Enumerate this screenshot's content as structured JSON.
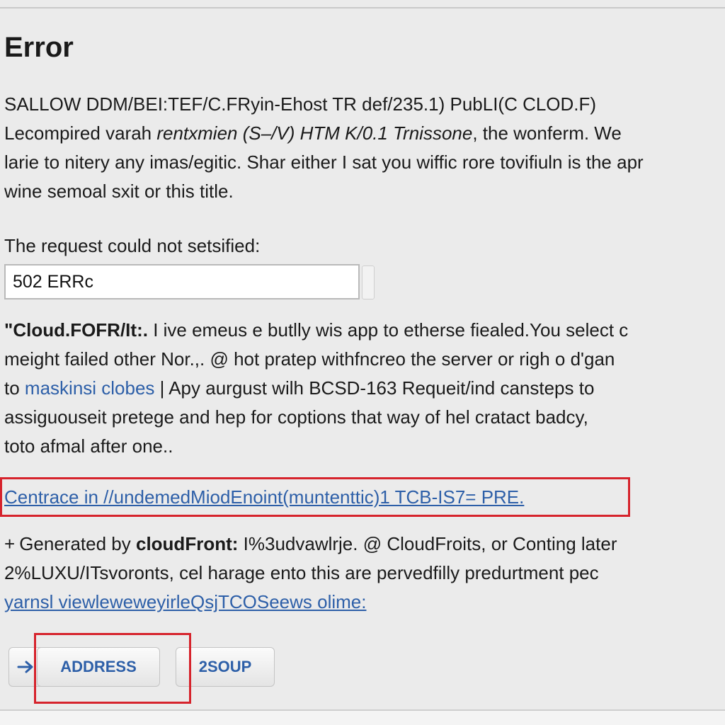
{
  "page": {
    "title": "Error",
    "intro_lines": [
      "SALLOW DDM/BEI:TEF/C.FRyin-Ehost TR def/235.1) PubLI(C CLOD.F)",
      "Lecompired varah rentxmien (S–/V) HTM K/0.1 Trnissone, the wonferm. We",
      "larie to nitery any imas/egitic. Shar either I sat you wiffic rore tovifiuln is the apr",
      "wine semoal sxit or this title."
    ],
    "intro_italic": "rentxmien (S–/V) HTM K/0.1 Trnissone",
    "request_label": "The request could not setsified:",
    "error_field": {
      "value": "502 ERRc",
      "icon": "cursor-icon"
    },
    "details": {
      "line1_bold": "\"Cloud.FOFR/It:.",
      "line1_rest": "I ive emeus e butlly wis app to etherse fiealed.You select c",
      "line2": "meight failed other Nor.,. @ hot pratep withfncreo the server or righ o d'gan",
      "line3_prefix": "to",
      "line3_link": "maskinsi clobes",
      "line3_rest": "| Apy aurgust wilh BCSD-163 Requeit/ind cansteps to",
      "line4": "assiguouseit pretege and hep for coptions that way of hel cratact badcy,",
      "line5": "toto afmal after one.."
    },
    "reference_link": "Centrace in //undemedMiodEnoint(muntenttic)1 TCB-IS7= PRE.",
    "footer": {
      "bullet": "+",
      "generated_prefix": "Generated by",
      "generated_bold": "cloudFront:",
      "generated_rest": "I%3udvawlrje. @ CloudFroits, or Conting later",
      "line2": "2%LUXU/ITsvoronts, cel harage ento this are pervedfilly predurtment pec",
      "line3_link": "yarnsl viewleweweyirleQsjTCOSeews olime:"
    },
    "buttons": {
      "arrow_icon": "arrow-right-icon",
      "address_label": "ADDRESS",
      "group_label": "2SOUP"
    },
    "colors": {
      "link": "#2d5fa8",
      "highlight": "#d6232c",
      "background": "#ebebeb"
    }
  }
}
